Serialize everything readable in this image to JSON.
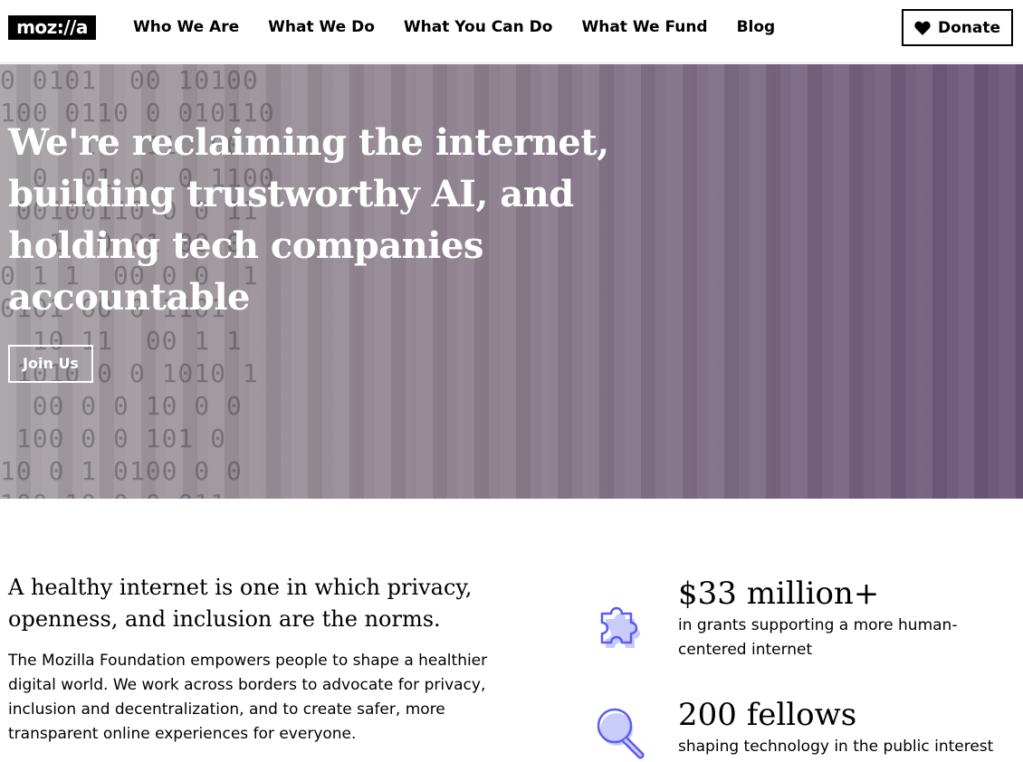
{
  "header": {
    "logo_text": "moz://a",
    "nav": [
      {
        "label": "Who We Are"
      },
      {
        "label": "What We Do"
      },
      {
        "label": "What You Can Do"
      },
      {
        "label": "What We Fund"
      },
      {
        "label": "Blog"
      }
    ],
    "donate_label": "Donate",
    "donate_icon": "heart-icon"
  },
  "hero": {
    "headline": "We're reclaiming the internet, building trustworthy AI, and holding tech companies accountable",
    "cta_label": "Join Us",
    "colors": {
      "gradient_start": "#a8a3a6",
      "gradient_end": "#6a5478",
      "text": "#ffffff"
    }
  },
  "main": {
    "intro": "A healthy internet is one in which privacy, openness, and inclusion are the norms.",
    "description": "The Mozilla Foundation empowers people to shape a healthier digital world. We work across borders to advocate for privacy, inclusion and decentralization, and to create safer, more transparent online experiences for everyone.",
    "stats": [
      {
        "icon": "puzzle-icon",
        "value": "$33 million+",
        "caption": "in grants supporting a more human-centered internet"
      },
      {
        "icon": "magnifier-icon",
        "value": "200 fellows",
        "caption": "shaping technology in the public interest"
      }
    ],
    "accent_color": "#595cf3"
  }
}
